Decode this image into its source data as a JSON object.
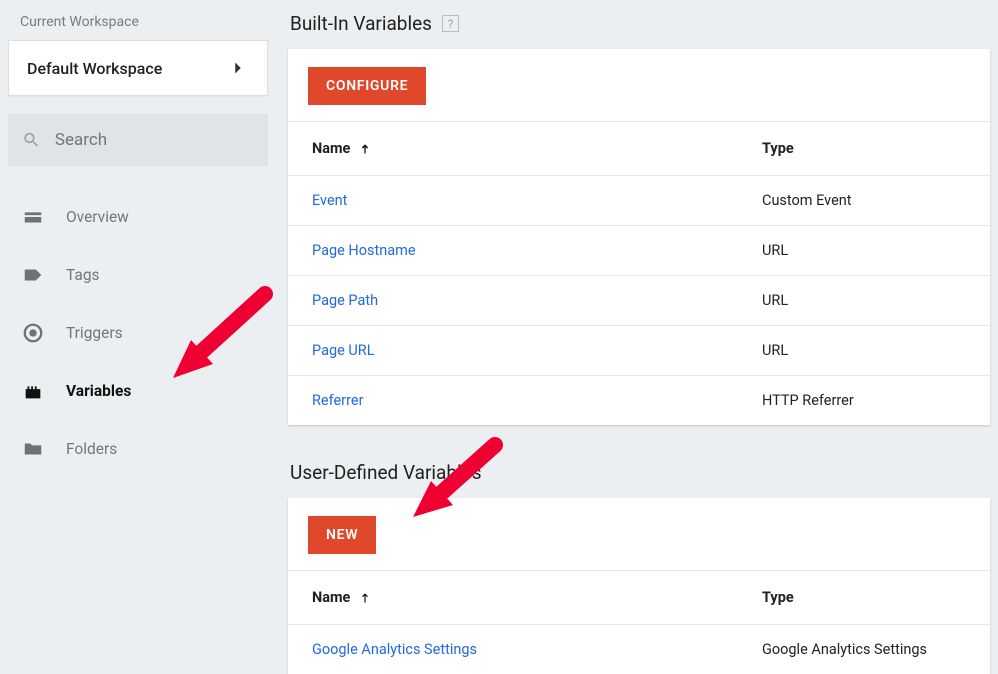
{
  "sidebar": {
    "ws_label": "Current Workspace",
    "ws_name": "Default Workspace",
    "search_placeholder": "Search",
    "nav": [
      {
        "id": "overview",
        "label": "Overview"
      },
      {
        "id": "tags",
        "label": "Tags"
      },
      {
        "id": "triggers",
        "label": "Triggers"
      },
      {
        "id": "variables",
        "label": "Variables"
      },
      {
        "id": "folders",
        "label": "Folders"
      }
    ],
    "active": "variables"
  },
  "builtins": {
    "title": "Built-In Variables",
    "help": "?",
    "configure": "Configure",
    "headers": {
      "name": "Name",
      "type": "Type"
    },
    "rows": [
      {
        "name": "Event",
        "type": "Custom Event"
      },
      {
        "name": "Page Hostname",
        "type": "URL"
      },
      {
        "name": "Page Path",
        "type": "URL"
      },
      {
        "name": "Page URL",
        "type": "URL"
      },
      {
        "name": "Referrer",
        "type": "HTTP Referrer"
      }
    ]
  },
  "user": {
    "title": "User-Defined Variables",
    "new": "New",
    "headers": {
      "name": "Name",
      "type": "Type"
    },
    "rows": [
      {
        "name": "Google Analytics Settings",
        "type": "Google Analytics Settings"
      }
    ]
  }
}
